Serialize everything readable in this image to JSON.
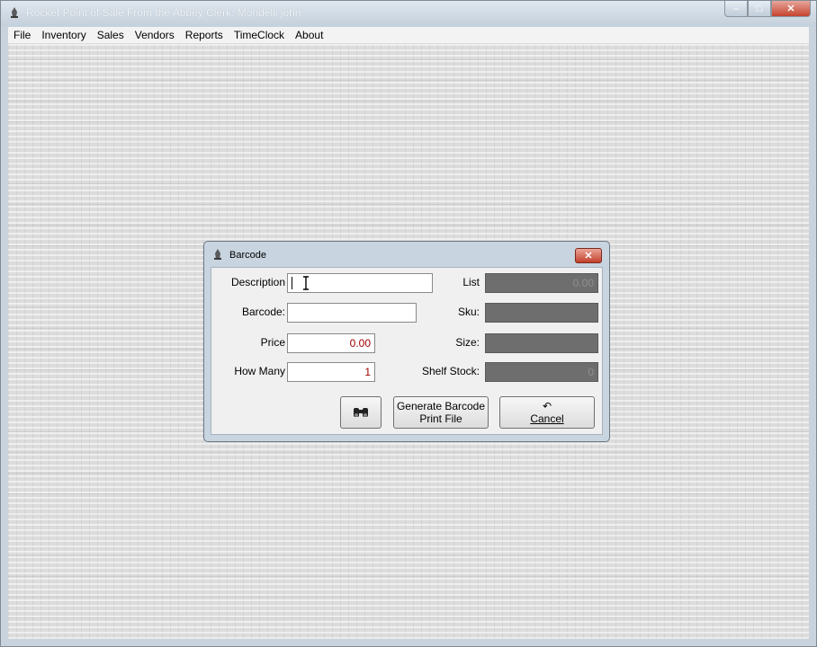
{
  "window": {
    "title": "Rocket Point of Sale   From the Abbey   Clerk: Mondelli john",
    "controls": {
      "minimize": "–",
      "maximize": "□",
      "close": "✕"
    }
  },
  "menu": {
    "items": [
      "File",
      "Inventory",
      "Sales",
      "Vendors",
      "Reports",
      "TimeClock",
      "About"
    ]
  },
  "dialog": {
    "title": "Barcode",
    "close_label": "✕",
    "fields": {
      "description": {
        "label": "Description",
        "value": ""
      },
      "barcode": {
        "label": "Barcode:",
        "value": ""
      },
      "price": {
        "label": "Price",
        "value": "0.00"
      },
      "how_many": {
        "label": "How Many",
        "value": "1"
      },
      "list": {
        "label": "List",
        "value": "0.00"
      },
      "sku": {
        "label": "Sku:",
        "value": ""
      },
      "size": {
        "label": "Size:",
        "value": ""
      },
      "shelf_stock": {
        "label": "Shelf Stock:",
        "value": "0"
      }
    },
    "buttons": {
      "search_icon": "binoculars-icon",
      "generate_line1": "Generate Barcode",
      "generate_line2": "Print File",
      "cancel_icon": "↶",
      "cancel_label": "Cancel"
    }
  },
  "colors": {
    "title_bar": "#c4d0dc",
    "close_button": "#c4432e",
    "price_text": "#a00000",
    "readonly_field": "#6e6e6e"
  }
}
